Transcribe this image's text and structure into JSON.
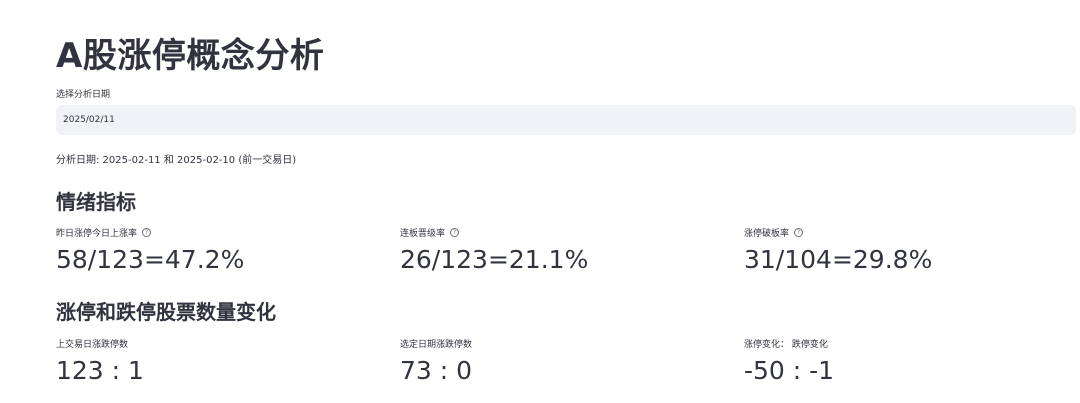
{
  "header": {
    "title": "A股涨停概念分析"
  },
  "date_picker": {
    "label": "选择分析日期",
    "value": "2025/02/11"
  },
  "analysis_note": "分析日期: 2025-02-11 和 2025-02-10 (前一交易日)",
  "sentiment": {
    "header": "情绪指标",
    "metrics": [
      {
        "label": "昨日涨停今日上涨率",
        "value": "58/123=47.2%",
        "has_help": true
      },
      {
        "label": "连板晋级率",
        "value": "26/123=21.1%",
        "has_help": true
      },
      {
        "label": "涨停破板率",
        "value": "31/104=29.8%",
        "has_help": true
      }
    ]
  },
  "limit_change": {
    "header": "涨停和跌停股票数量变化",
    "metrics": [
      {
        "label": "上交易日涨跌停数",
        "value": "123 : 1"
      },
      {
        "label": "选定日期涨跌停数",
        "value": "73 : 0"
      },
      {
        "label": "涨停变化： 跌停变化",
        "value": "-50 : -1"
      }
    ]
  },
  "icons": {
    "help": "question-circle-icon"
  }
}
